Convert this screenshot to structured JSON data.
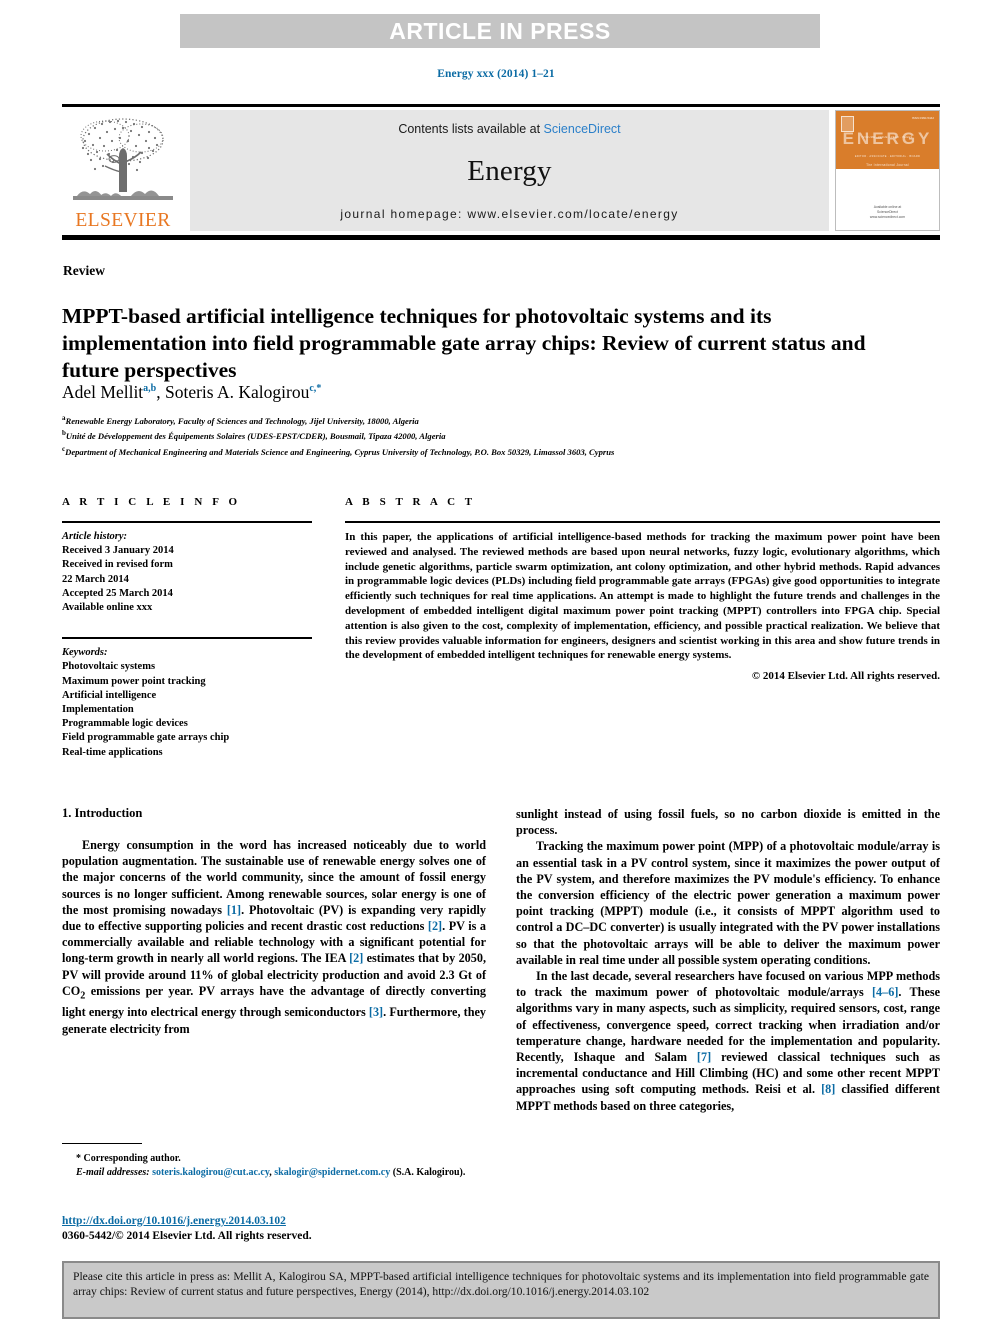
{
  "banner": {
    "label": "ARTICLE IN PRESS"
  },
  "running_head": "Energy xxx (2014) 1–21",
  "masthead": {
    "contents_prefix": "Contents lists available at ",
    "sciencedirect": "ScienceDirect",
    "journal_title": "Energy",
    "homepage": "journal homepage: www.elsevier.com/locate/energy",
    "publisher_name": "ELSEVIER",
    "publisher_logo_icon": "elsevier-tree-logo",
    "cover_word": "ENERGY",
    "cover_note": "Available online at\nScienceDirect\nwww.sciencedirect.com"
  },
  "article_type": "Review",
  "title": "MPPT-based artificial intelligence techniques for photovoltaic systems and its implementation into field programmable gate array chips: Review of current status and future perspectives",
  "authors": {
    "author1_name": "Adel Mellit",
    "author1_sup": "a,b",
    "separator": ", ",
    "author2_name": "Soteris A. Kalogirou",
    "author2_sup": "c,",
    "corresponding_star": "*"
  },
  "affiliations": [
    {
      "marker": "a",
      "text": "Renewable Energy Laboratory, Faculty of Sciences and Technology, Jijel University, 18000, Algeria"
    },
    {
      "marker": "b",
      "text": "Unité de Développement des Équipements Solaires (UDES-EPST/CDER), Bousmail, Tipaza 42000, Algeria"
    },
    {
      "marker": "c",
      "text": "Department of Mechanical Engineering and Materials Science and Engineering, Cyprus University of Technology, P.O. Box 50329, Limassol 3603, Cyprus"
    }
  ],
  "article_info": {
    "heading": "A R T I C L E   I N F O",
    "history_label": "Article history:",
    "history": [
      "Received 3 January 2014",
      "Received in revised form",
      "22 March 2014",
      "Accepted 25 March 2014",
      "Available online xxx"
    ],
    "keywords_label": "Keywords:",
    "keywords": [
      "Photovoltaic systems",
      "Maximum power point tracking",
      "Artificial intelligence",
      "Implementation",
      "Programmable logic devices",
      "Field programmable gate arrays chip",
      "Real-time applications"
    ]
  },
  "abstract": {
    "heading": "A B S T R A C T",
    "text": "In this paper, the applications of artificial intelligence-based methods for tracking the maximum power point have been reviewed and analysed. The reviewed methods are based upon neural networks, fuzzy logic, evolutionary algorithms, which include genetic algorithms, particle swarm optimization, ant colony optimization, and other hybrid methods. Rapid advances in programmable logic devices (PLDs) including field programmable gate arrays (FPGAs) give good opportunities to integrate efficiently such techniques for real time applications. An attempt is made to highlight the future trends and challenges in the development of embedded intelligent digital maximum power point tracking (MPPT) controllers into FPGA chip. Special attention is also given to the cost, complexity of implementation, efficiency, and possible practical realization. We believe that this review provides valuable information for engineers, designers and scientist working in this area and show future trends in the development of embedded intelligent techniques for renewable energy systems.",
    "copyright": "© 2014 Elsevier Ltd. All rights reserved."
  },
  "body": {
    "section_number_title": "1.  Introduction",
    "left_paragraph_1_parts": [
      "Energy consumption in the word has increased noticeably due to world population augmentation. The sustainable use of renewable energy solves one of the major concerns of the world community, since the amount of fossil energy sources is no longer sufficient. Among renewable sources, solar energy is one of the most promising nowadays ",
      "[1]",
      ". Photovoltaic (PV) is expanding very rapidly due to effective supporting policies and recent drastic cost reductions ",
      "[2]",
      ". PV is a commercially available and reliable technology with a significant potential for long-term growth in nearly all world regions. The IEA ",
      "[2]",
      " estimates that by 2050, PV will provide around 11% of global electricity production and avoid 2.3 Gt of CO",
      "2",
      " emissions per year. PV arrays have the advantage of directly converting light energy into electrical energy through semiconductors ",
      "[3]",
      ". Furthermore, they generate electricity from"
    ],
    "right_paragraph_1": "sunlight instead of using fossil fuels, so no carbon dioxide is emitted in the process.",
    "right_paragraph_2": "Tracking the maximum power point (MPP) of a photovoltaic module/array is an essential task in a PV control system, since it maximizes the power output of the PV system, and therefore maximizes the PV module's efficiency. To enhance the conversion efficiency of the electric power generation a maximum power point tracking (MPPT) module (i.e., it consists of MPPT algorithm used to control a DC–DC converter) is usually integrated with the PV power installations so that the photovoltaic arrays will be able to deliver the maximum power available in real time under all possible system operating conditions.",
    "right_paragraph_3_parts": [
      "In the last decade, several researchers have focused on various MPP methods to track the maximum power of photovoltaic module/arrays ",
      "[4–6]",
      ". These algorithms vary in many aspects, such as simplicity, required sensors, cost, range of effectiveness, convergence speed, correct tracking when irradiation and/or temperature change, hardware needed for the implementation and popularity. Recently, Ishaque and Salam ",
      "[7]",
      " reviewed classical techniques such as incremental conductance and Hill Climbing (HC) and some other recent MPPT approaches using soft computing methods. Reisi et al. ",
      "[8]",
      " classified different MPPT methods based on three categories,"
    ]
  },
  "footnote": {
    "corresponding_marker": "*",
    "corresponding_label": "Corresponding author.",
    "email_label": "E-mail addresses:",
    "email_1": "soteris.kalogirou@cut.ac.cy",
    "email_sep": ", ",
    "email_2": "skalogir@spidernet.com.cy",
    "email_owner": "(S.A. Kalogirou)."
  },
  "doi": {
    "url": "http://dx.doi.org/10.1016/j.energy.2014.03.102",
    "copyright": "0360-5442/© 2014 Elsevier Ltd. All rights reserved."
  },
  "citation_box": {
    "text": "Please cite this article in press as: Mellit A, Kalogirou SA, MPPT-based artificial intelligence techniques for photovoltaic systems and its implementation into field programmable gate array chips: Review of current status and future perspectives, Energy (2014), http://dx.doi.org/10.1016/j.energy.2014.03.102"
  },
  "colors": {
    "link_blue": "#0b6ba4",
    "sciencedirect_blue": "#2a7fc9",
    "elsevier_orange": "#e87722",
    "banner_gray": "#c4c4c4",
    "masthead_gray": "#e6e6e6",
    "cite_box_gray": "#c9c9c9"
  }
}
